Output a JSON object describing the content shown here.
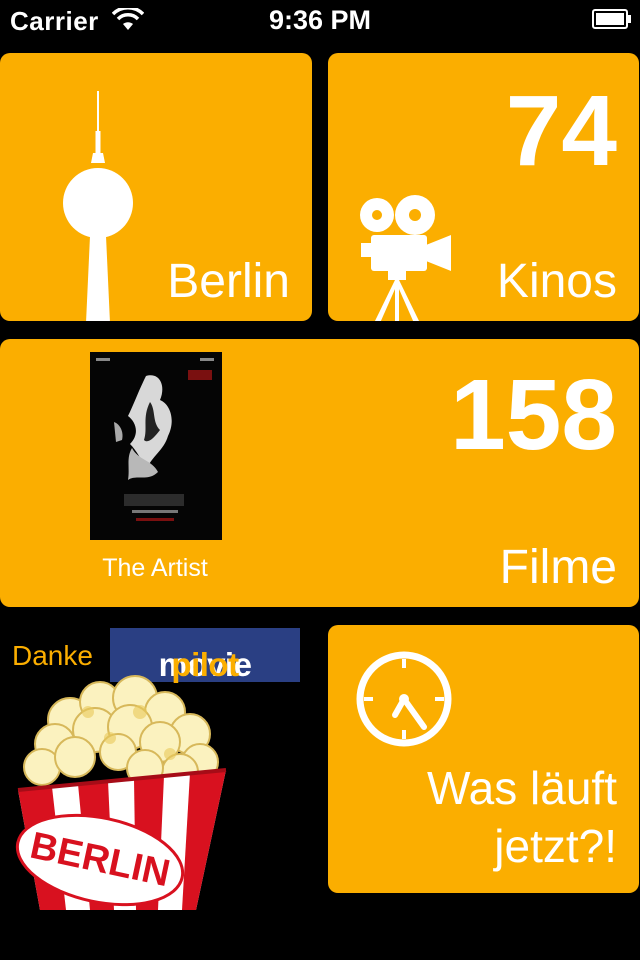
{
  "status_bar": {
    "carrier": "Carrier",
    "time": "9:36 PM"
  },
  "tiles": {
    "city": {
      "label": "Berlin"
    },
    "cinemas": {
      "count": "74",
      "label": "Kinos"
    },
    "films": {
      "count": "158",
      "label": "Filme",
      "featured_title": "The Artist"
    },
    "now_showing": {
      "line1": "Was läuft",
      "line2": "jetzt?!"
    }
  },
  "credits": {
    "thanks": "Danke",
    "brand_a": "movie",
    "brand_b": "pilot",
    "popcorn_text": "BERLIN"
  },
  "colors": {
    "accent": "#fbae00",
    "background": "#000000",
    "brand_bg": "#2a3f83",
    "popcorn_red": "#d8111f"
  },
  "icons": [
    "wifi-icon",
    "battery-icon",
    "tv-tower-icon",
    "movie-camera-icon",
    "clock-icon",
    "popcorn-icon"
  ]
}
